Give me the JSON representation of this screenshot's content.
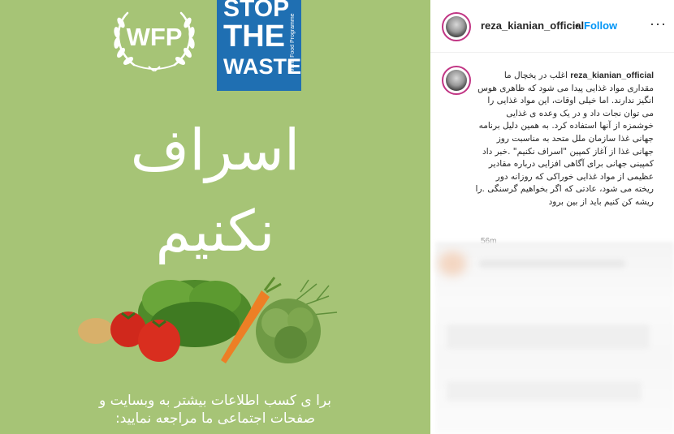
{
  "poster": {
    "wfp_logo_text": "WFP",
    "stop_the_waste": [
      "STOP",
      "THE",
      "WASTE"
    ],
    "side_text": "World Food Programme",
    "headline_line1": "اسراف",
    "headline_line2": "نکنیم",
    "footer_line1": "برا ی کسب اطلاعات بیشتر به وبسایت و",
    "footer_line2": "صفحات اجتماعی ما مراجعه نمایید:",
    "colors": {
      "background": "#a6c476",
      "stw_box": "#1f6fb2"
    }
  },
  "post": {
    "username": "reza_kianian_official",
    "dot": "•",
    "follow_label": "Follow",
    "more_icon": "more-options-icon",
    "caption_username": "reza_kianian_official",
    "caption_paragraph1": "اغلب در یخچال ما مقداری مواد غذایی پیدا می شود که ظاهری هوس انگیز ندارند. اما خیلی اوقات، این مواد غذایی را می توان نجات داد و در یک وعده ی غذایی خوشمزه از آنها استفاده کرد. به همین دلیل برنامه جهانی غذا سازمان ملل متحد به مناسبت روز جهانی غذا از آغاز کمپین \"اسراف نکنیم\" .خبر داد",
    "caption_paragraph2": "کمپینی جهانی برای آگاهی افزایی درباره مقادیر عظیمی از مواد غذایی خوراکی که روزانه دور ریخته می شود، عادتی که اگر بخواهیم گرسنگی .را ریشه کن کنیم باید از بین برود",
    "time": "56m",
    "accent_color": "#0095f6"
  }
}
